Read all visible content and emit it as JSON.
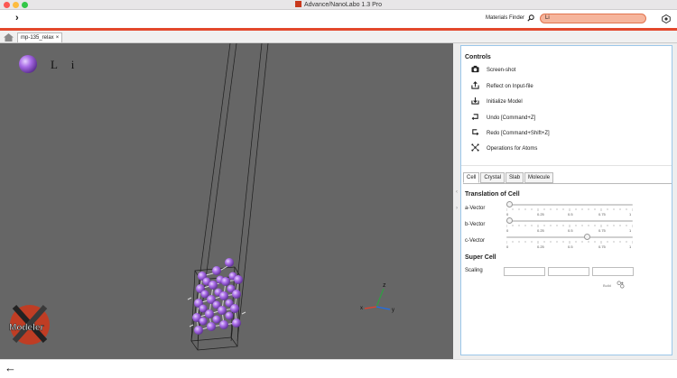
{
  "window": {
    "title": "Advance/NanoLabo 1.3 Pro"
  },
  "toolbar": {
    "forward_glyph": "›",
    "materials_finder_label": "Materials Finder",
    "search_value": "Li"
  },
  "tabs": {
    "file_tab_label": "mp-135_relax",
    "close_glyph": "×"
  },
  "viewer": {
    "element_label": "L i",
    "logo_text": "Modeler",
    "axes": {
      "x": "x",
      "y": "y",
      "z": "z"
    }
  },
  "controls": {
    "title": "Controls",
    "items": [
      {
        "label": "Screen-shot",
        "icon": "camera-icon"
      },
      {
        "label": "Reflect on Input-file",
        "icon": "export-icon"
      },
      {
        "label": "Initialize Model",
        "icon": "import-icon"
      },
      {
        "label": "Undo [Command+Z]",
        "icon": "undo-icon"
      },
      {
        "label": "Redo [Command+Shift+Z]",
        "icon": "redo-icon"
      },
      {
        "label": "Operations for Atoms",
        "icon": "atoms-icon"
      }
    ]
  },
  "subtabs": [
    "Cell",
    "Crystal",
    "Slab",
    "Molecule"
  ],
  "translation": {
    "title": "Translation of Cell",
    "vectors": [
      {
        "label": "a-Vector",
        "value": 0
      },
      {
        "label": "b-Vector",
        "value": 0
      },
      {
        "label": "c-Vector",
        "value": 0.65
      }
    ],
    "tick_labels": [
      "0",
      "0.25",
      "0.5",
      "0.75",
      "1"
    ]
  },
  "supercell": {
    "title": "Super Cell",
    "scaling_label": "Scaling",
    "build_label": "Build"
  },
  "colors": {
    "accent": "#e3482c",
    "search_fill": "#f6b59c",
    "atom": "#9b59d8",
    "viewer_bg": "#666666",
    "panel_border": "#9bc7e9"
  },
  "bottom": {
    "back_glyph": "←"
  }
}
